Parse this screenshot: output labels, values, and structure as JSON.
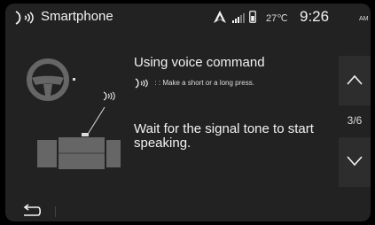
{
  "status_bar": {
    "app_icon": "voice-recognition-icon",
    "title": "Smartphone",
    "nav_icon": "navigation-arrow-icon",
    "signal_icon": "signal-bars-icon",
    "phone_icon": "phone-battery-icon",
    "temperature": "27℃",
    "time": "9:26",
    "ampm": "AM"
  },
  "content": {
    "illustration": "steering-wheel-voice-button-illustration",
    "heading": "Using voice command",
    "voice_icon": "voice-recognition-icon",
    "hint": ": : Make a short or a long press.",
    "instruction": "Wait for the signal tone to start speaking."
  },
  "pager": {
    "up_icon": "chevron-up-icon",
    "indicator": "3/6",
    "down_icon": "chevron-down-icon"
  },
  "bottom_bar": {
    "back_icon": "back-arrow-icon"
  },
  "colors": {
    "background": "#222222",
    "text": "#f2f2f2",
    "secondary_text": "#dcdcdc",
    "button": "#2d2d2d",
    "illustration": "#666666"
  }
}
